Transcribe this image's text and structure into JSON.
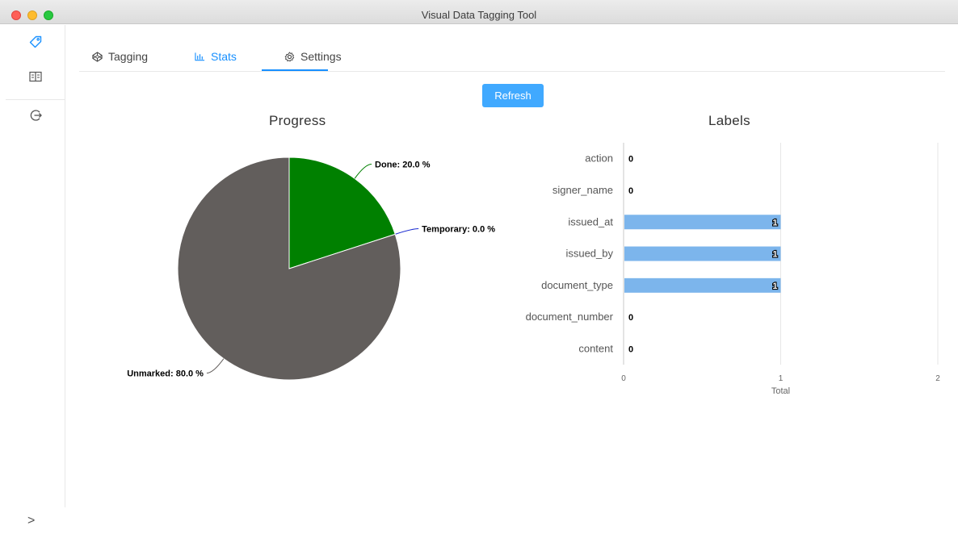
{
  "window": {
    "title": "Visual Data Tagging Tool"
  },
  "sidebar": {
    "items": [
      {
        "icon": "tag-icon",
        "active": true
      },
      {
        "icon": "book-icon",
        "active": false
      },
      {
        "icon": "logout-icon",
        "active": false
      }
    ],
    "collapse_label": ">"
  },
  "tabs": [
    {
      "label": "Tagging",
      "icon": "codepen-icon",
      "active": false
    },
    {
      "label": "Stats",
      "icon": "bar-chart-icon",
      "active": true
    },
    {
      "label": "Settings",
      "icon": "gear-icon",
      "active": false
    }
  ],
  "refresh_label": "Refresh",
  "colors": {
    "accent": "#1890ff",
    "done": "#008000",
    "unmarked": "#625e5c",
    "temporary": "#1a2bd1",
    "bar": "#7cb5ec"
  },
  "chart_data": [
    {
      "type": "pie",
      "title": "Progress",
      "slices": [
        {
          "name": "Done",
          "value": 20.0,
          "label": "Done: 20.0 %",
          "color": "#008000"
        },
        {
          "name": "Temporary",
          "value": 0.0,
          "label": "Temporary: 0.0 %",
          "color": "#1a2bd1"
        },
        {
          "name": "Unmarked",
          "value": 80.0,
          "label": "Unmarked: 80.0 %",
          "color": "#625e5c"
        }
      ]
    },
    {
      "type": "bar",
      "orientation": "horizontal",
      "title": "Labels",
      "categories": [
        "action",
        "signer_name",
        "issued_at",
        "issued_by",
        "document_type",
        "document_number",
        "content"
      ],
      "values": [
        0,
        0,
        1,
        1,
        1,
        0,
        0
      ],
      "xlabel": "Total",
      "xlim": [
        0,
        2
      ],
      "xticks": [
        "0",
        "1",
        "2"
      ],
      "grid": true
    }
  ]
}
